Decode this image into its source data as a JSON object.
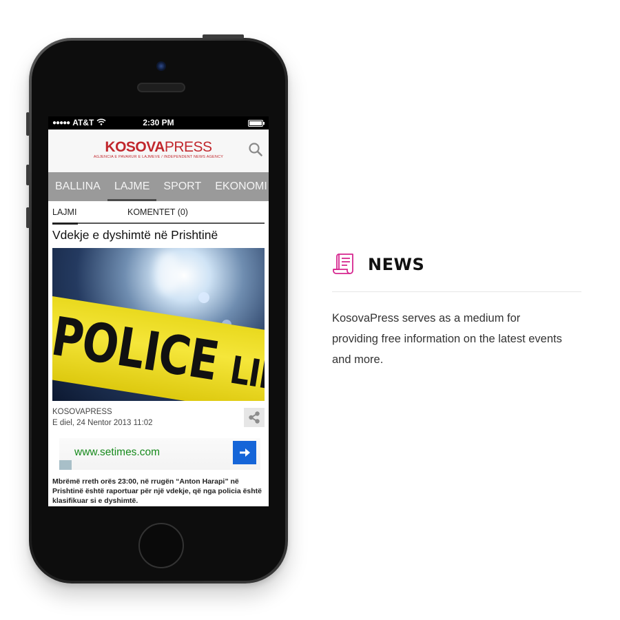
{
  "status_bar": {
    "signal": "●●●●●",
    "carrier": "AT&T",
    "wifi_icon": "wifi-icon",
    "time": "2:30 PM",
    "battery_level": 1.0
  },
  "app": {
    "logo": {
      "part1": "KOSOVA",
      "part2": "PRESS",
      "tagline": "AGJENCIA E PAVARUR E LAJMEVE / INDEPENDENT NEWS AGENCY",
      "color": "#c1272d"
    },
    "search_icon": "search-icon",
    "nav_tabs": [
      {
        "label": "BALLINA"
      },
      {
        "label": "LAJME"
      },
      {
        "label": "SPORT"
      },
      {
        "label": "EKONOMI"
      }
    ],
    "active_nav": "LAJME",
    "sub_tabs": [
      {
        "label": "LAJMI"
      },
      {
        "label": "KOMENTET (0)"
      }
    ],
    "article": {
      "title": "Vdekje e dyshimtë në Prishtinë",
      "image_text_main": "POLICE",
      "image_text_small": "LINE DO NOT",
      "source": "KOSOVAPRESS",
      "date": "E diel, 24 Nentor 2013 11:02",
      "share_icon": "share-icon",
      "body": "Mbrëmë rreth orës 23:00, në rrugën “Anton Harapi” në Prishtinë është raportuar për një vdekje, që nga policia është klasifikuar si e dyshimtë."
    },
    "ad": {
      "url": "www.setimes.com",
      "arrow_icon": "arrow-right-icon",
      "accent": "#1565d8"
    }
  },
  "feature": {
    "icon": "receipt-icon",
    "icon_color": "#d6268f",
    "title": "NEWS",
    "description": "KosovaPress serves as a medium for providing free information on the latest events and more."
  }
}
